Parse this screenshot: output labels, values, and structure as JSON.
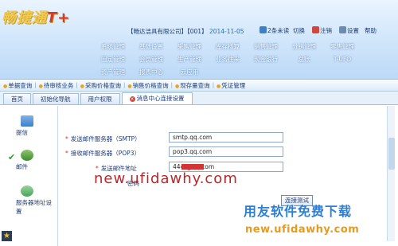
{
  "header": {
    "logo_text": "畅捷通",
    "logo_suffix": "T+",
    "company": "【畅达洁具有限公司】【001】",
    "date": "2014-11-05",
    "notice": "2条未读",
    "switch_label": "切换",
    "logout_label": "注销",
    "settings_label": "设置",
    "help_label": "帮助"
  },
  "menu": {
    "row1": [
      "系统管理",
      "基础设置",
      "采购管理",
      "库存核算",
      "销售管理",
      "分销管理",
      "零售管理"
    ],
    "row2": [
      "固定管理",
      "会员管理",
      "生产管理",
      "业务往来",
      "现金银行",
      "总账",
      "T-UFO"
    ],
    "row3": [
      "资产管理",
      "报表中心",
      "云应用"
    ]
  },
  "quickbar": [
    "单据查询",
    "待审核业务",
    "采购价格查询",
    "销售价格查询",
    "现存量查询",
    "凭证管理"
  ],
  "tabs": [
    "首页",
    "初始化导航",
    "用户权限",
    "消息中心连接设置"
  ],
  "left_panel": {
    "reminder": "提信",
    "mail": "邮件",
    "server": "服务器地址设置"
  },
  "form": {
    "smtp_label": "发送邮件服务器（SMTP）",
    "smtp_value": "smtp.qq.com",
    "pop3_label": "接收邮件服务器（POP3）",
    "pop3_value": "pop3.qq.com",
    "sender_label": "发送邮件地址",
    "sender_value": "444          @qq.com",
    "password_label": "密码",
    "test_button": "连接测试"
  },
  "watermark": {
    "url": "new.ufidawhy.com",
    "slogan": "用友软件免费下载",
    "url2": "new.ufidawhy.com"
  },
  "colors": {
    "header_bg": "#cfe5fb",
    "accent": "#1d3c78",
    "required_star": "#d0312d",
    "watermark_red": "#b8282a",
    "watermark_blue": "#2b7fd6",
    "watermark_orange": "#e89a1a"
  }
}
